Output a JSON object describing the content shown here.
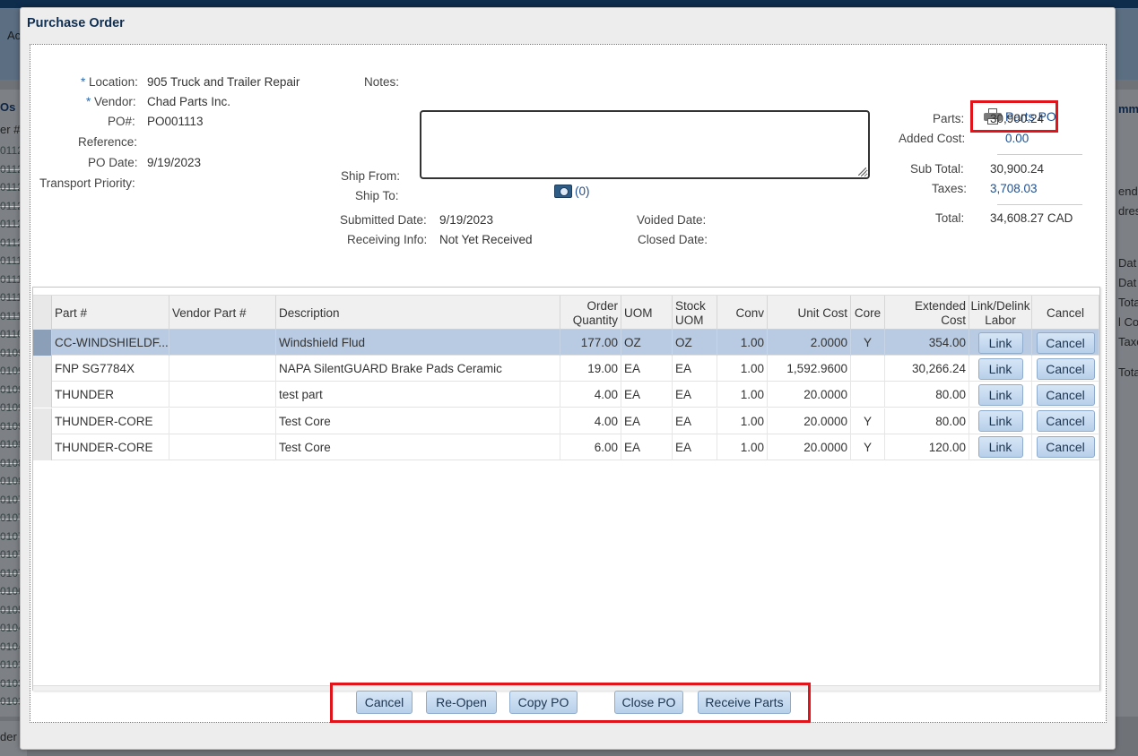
{
  "dialog": {
    "title": "Purchase Order"
  },
  "header": {
    "location_label": "Location:",
    "location": "905 Truck and Trailer Repair",
    "vendor_label": "Vendor:",
    "vendor": "Chad Parts Inc.",
    "po_label": "PO#:",
    "po_number": "PO001113",
    "reference_label": "Reference:",
    "reference": "",
    "po_date_label": "PO Date:",
    "po_date": "9/19/2023",
    "transport_label": "Transport Priority:",
    "transport": "",
    "required_mark": "*"
  },
  "notes": {
    "label": "Notes:",
    "value": "",
    "attachments": "(0)"
  },
  "shipping": {
    "ship_from_label": "Ship From:",
    "ship_to_label": "Ship To:",
    "submitted_label": "Submitted Date:",
    "submitted": "9/19/2023",
    "receiving_label": "Receiving Info:",
    "receiving": "Not Yet Received",
    "voided_label": "Voided Date:",
    "closed_label": "Closed Date:"
  },
  "summary": {
    "print_label": "Parts PO",
    "parts_label": "Parts:",
    "parts": "30,900.24",
    "added_label": "Added Cost:",
    "added": "0.00",
    "subtotal_label": "Sub Total:",
    "subtotal": "30,900.24",
    "taxes_label": "Taxes:",
    "taxes": "3,708.03",
    "total_label": "Total:",
    "total": "34,608.27",
    "currency": "CAD"
  },
  "grid": {
    "columns": [
      "Part #",
      "Vendor Part #",
      "Description",
      "Order Quantity",
      "UOM",
      "Stock UOM",
      "Conv",
      "Unit Cost",
      "Core",
      "Extended Cost",
      "Link/Delink Labor",
      "Cancel"
    ],
    "link_label": "Link",
    "cancel_label": "Cancel",
    "rows": [
      {
        "part": "CC-WINDSHIELDF...",
        "vendor_part": "",
        "description": "Windshield Flud",
        "qty": "177.00",
        "uom": "OZ",
        "stock_uom": "OZ",
        "conv": "1.00",
        "unit_cost": "2.0000",
        "core": "Y",
        "extended": "354.00"
      },
      {
        "part": "FNP SG7784X",
        "vendor_part": "",
        "description": "NAPA SilentGUARD Brake Pads Ceramic",
        "qty": "19.00",
        "uom": "EA",
        "stock_uom": "EA",
        "conv": "1.00",
        "unit_cost": "1,592.9600",
        "core": "",
        "extended": "30,266.24"
      },
      {
        "part": "THUNDER",
        "vendor_part": "",
        "description": "test part",
        "qty": "4.00",
        "uom": "EA",
        "stock_uom": "EA",
        "conv": "1.00",
        "unit_cost": "20.0000",
        "core": "",
        "extended": "80.00"
      },
      {
        "part": "THUNDER-CORE",
        "vendor_part": "",
        "description": "Test Core",
        "qty": "4.00",
        "uom": "EA",
        "stock_uom": "EA",
        "conv": "1.00",
        "unit_cost": "20.0000",
        "core": "Y",
        "extended": "80.00"
      },
      {
        "part": "THUNDER-CORE",
        "vendor_part": "",
        "description": "Test Core",
        "qty": "6.00",
        "uom": "EA",
        "stock_uom": "EA",
        "conv": "1.00",
        "unit_cost": "20.0000",
        "core": "Y",
        "extended": "120.00"
      }
    ]
  },
  "actions": {
    "cancel": "Cancel",
    "reopen": "Re-Open",
    "copy": "Copy PO",
    "close": "Close PO",
    "receive": "Receive Parts"
  },
  "background": {
    "left_tab": "Os",
    "left_header": "er #",
    "left_rows": [
      "0112",
      "0112",
      "0112",
      "0112",
      "0112",
      "0112",
      "0111",
      "0111",
      "0111",
      "0111",
      "0110",
      "0109",
      "0109",
      "0109",
      "0109",
      "0109",
      "0108",
      "0108",
      "0108",
      "0107",
      "0107",
      "0107",
      "0107",
      "0107",
      "0106",
      "0105",
      "0104",
      "0104",
      "0103",
      "0103",
      "0103"
    ],
    "right_items": [
      "mma",
      "endo",
      "dres",
      "Dat",
      "Dat",
      "Tota",
      "l Cos",
      "Taxe",
      "Tota"
    ],
    "top_left": "Ac",
    "bottom_left": "der"
  },
  "colors": {
    "accent_red": "#e0141a",
    "link_blue": "#1f4f8f",
    "selected_row": "#b9cbe2"
  }
}
